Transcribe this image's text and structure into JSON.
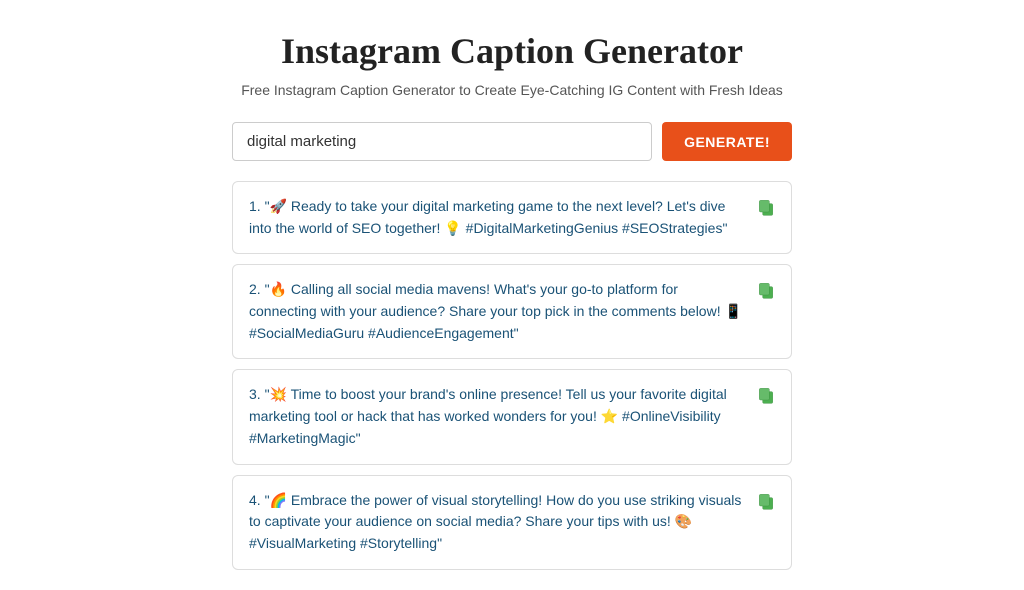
{
  "header": {
    "title": "Instagram Caption Generator",
    "subtitle": "Free Instagram Caption Generator to Create Eye-Catching IG Content with Fresh Ideas"
  },
  "search": {
    "input_value": "digital marketing",
    "placeholder": "digital marketing",
    "button_label": "GENERATE!"
  },
  "results": [
    {
      "id": 1,
      "text": "1. \"🚀 Ready to take your digital marketing game to the next level? Let's dive into the world of SEO together! 💡 #DigitalMarketingGenius #SEOStrategies\""
    },
    {
      "id": 2,
      "text": "2. \"🔥 Calling all social media mavens! What's your go-to platform for connecting with your audience? Share your top pick in the comments below! 📱 #SocialMediaGuru #AudienceEngagement\""
    },
    {
      "id": 3,
      "text": "3. \"💥 Time to boost your brand's online presence! Tell us your favorite digital marketing tool or hack that has worked wonders for you! ⭐ #OnlineVisibility #MarketingMagic\""
    },
    {
      "id": 4,
      "text": "4. \"🌈 Embrace the power of visual storytelling! How do you use striking visuals to captivate your audience on social media? Share your tips with us! 🎨 #VisualMarketing #Storytelling\""
    }
  ]
}
